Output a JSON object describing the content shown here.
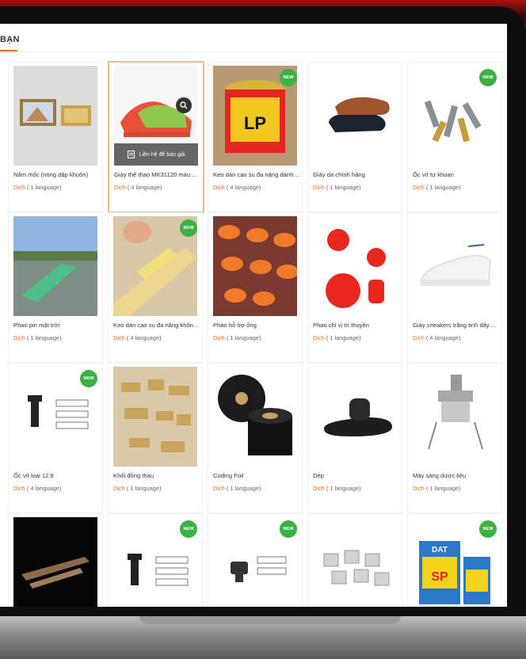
{
  "section": {
    "title": "BẠN"
  },
  "accent_color": "#e8701e",
  "new_badge_color": "#3cb043",
  "hover": {
    "contact_label": "Liên hệ để báo giá"
  },
  "products": [
    {
      "name": "Nắm mốc (nóng dập khuôn)",
      "dich": "Dịch",
      "lang": "( 1 language)",
      "new": false
    },
    {
      "name": "Giày thể thao MK31120 màu ...",
      "dich": "Dịch",
      "lang": "( 4 language)",
      "new": false
    },
    {
      "name": "Keo dán cao su đa năng dành ...",
      "dich": "Dịch",
      "lang": "( 4 language)",
      "new": true
    },
    {
      "name": "Giày da chính hãng",
      "dich": "Dịch",
      "lang": "( 1 language)",
      "new": false
    },
    {
      "name": "Ốc vít tự khoan",
      "dich": "Dịch",
      "lang": "( 1 language)",
      "new": true
    },
    {
      "name": "Phao pin mặt trời",
      "dich": "Dịch",
      "lang": "( 1 language)",
      "new": false
    },
    {
      "name": "Keo dán cao su đa năng khôn...",
      "dich": "Dịch",
      "lang": "( 4 language)",
      "new": true
    },
    {
      "name": "Phao hỗ trợ ống",
      "dich": "Dịch",
      "lang": "( 1 language)",
      "new": false
    },
    {
      "name": "Phao chỉ vị trí thuyền",
      "dich": "Dịch",
      "lang": "( 1 language)",
      "new": false
    },
    {
      "name": "Giày sneakers trắng tinh dây ...",
      "dich": "Dịch",
      "lang": "( 4 language)",
      "new": false
    },
    {
      "name": "Ốc vít loại 12.9",
      "dich": "Dịch",
      "lang": "( 4 language)",
      "new": true
    },
    {
      "name": "Khối đồng thau",
      "dich": "Dịch",
      "lang": "( 1 language)",
      "new": false
    },
    {
      "name": "Coding Foil",
      "dich": "Dịch",
      "lang": "( 1 language)",
      "new": false
    },
    {
      "name": "Dép",
      "dich": "Dịch",
      "lang": "( 1 language)",
      "new": false
    },
    {
      "name": "Máy sàng dược liệu",
      "dich": "Dịch",
      "lang": "( 1 language)",
      "new": false
    },
    {
      "name": "",
      "dich": "",
      "lang": "",
      "new": false
    },
    {
      "name": "",
      "dich": "",
      "lang": "",
      "new": true
    },
    {
      "name": "",
      "dich": "",
      "lang": "",
      "new": true
    },
    {
      "name": "",
      "dich": "",
      "lang": "",
      "new": false
    },
    {
      "name": "",
      "dich": "",
      "lang": "",
      "new": true
    }
  ],
  "badges": {
    "new": "NEW"
  },
  "thumb_texts": {
    "lp": "LP",
    "dat": "DAT",
    "sp": "SP"
  }
}
